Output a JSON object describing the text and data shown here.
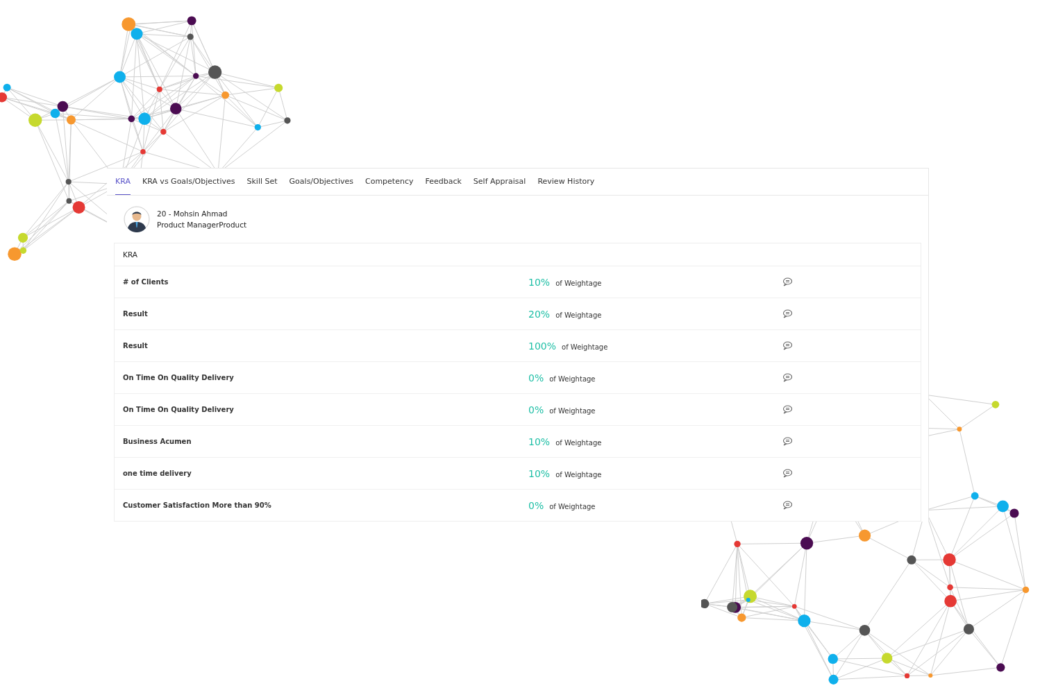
{
  "tabs": [
    {
      "label": "KRA",
      "selected": true
    },
    {
      "label": "KRA vs Goals/Objectives",
      "selected": false
    },
    {
      "label": "Skill Set",
      "selected": false
    },
    {
      "label": "Goals/Objectives",
      "selected": false
    },
    {
      "label": "Competency",
      "selected": false
    },
    {
      "label": "Feedback",
      "selected": false
    },
    {
      "label": "Self Appraisal",
      "selected": false
    },
    {
      "label": "Review History",
      "selected": false
    }
  ],
  "employee": {
    "name": "20 - Mohsin Ahmad",
    "role": "Product ManagerProduct"
  },
  "table": {
    "heading": "KRA",
    "rows": [
      {
        "name": "# of Clients",
        "percent": "10%",
        "suffix": "of Weightage"
      },
      {
        "name": "Result",
        "percent": "20%",
        "suffix": "of Weightage"
      },
      {
        "name": "Result",
        "percent": "100%",
        "suffix": "of Weightage"
      },
      {
        "name": "On Time On Quality Delivery",
        "percent": "0%",
        "suffix": "of Weightage"
      },
      {
        "name": "On Time On Quality Delivery",
        "percent": "0%",
        "suffix": "of Weightage"
      },
      {
        "name": "Business Acumen",
        "percent": "10%",
        "suffix": "of Weightage"
      },
      {
        "name": "one time delivery",
        "percent": "10%",
        "suffix": "of Weightage"
      },
      {
        "name": "Customer Satisfaction More than 90%",
        "percent": "0%",
        "suffix": "of Weightage"
      }
    ]
  }
}
